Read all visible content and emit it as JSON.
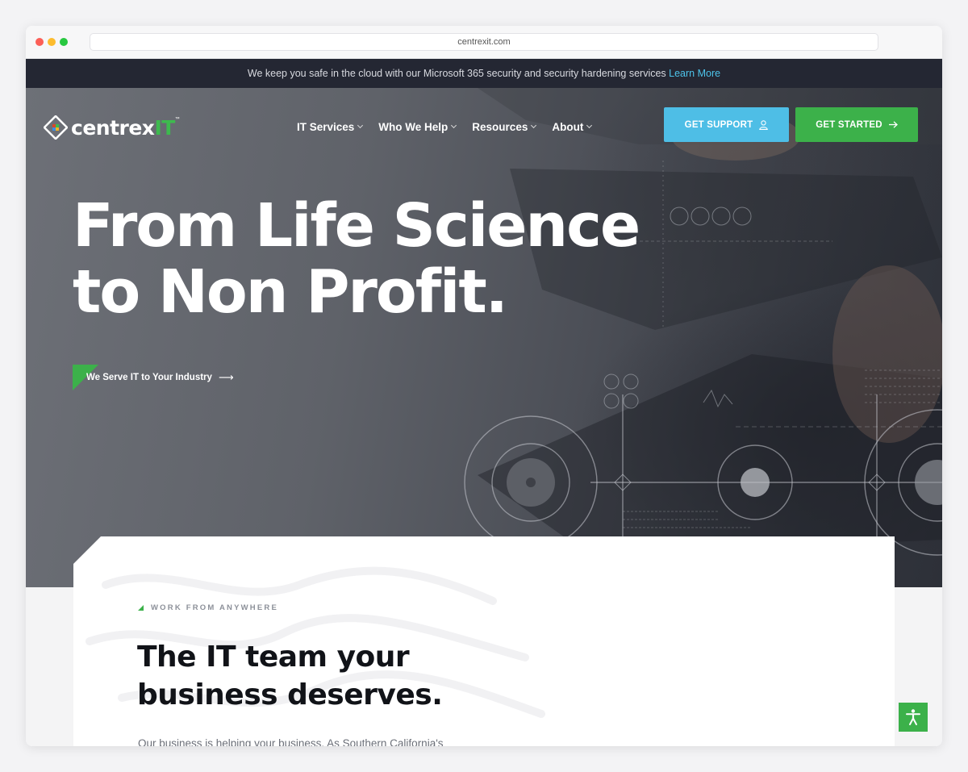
{
  "browser": {
    "url": "centrexit.com"
  },
  "announcement": {
    "text": "We keep you safe in the cloud with our Microsoft 365 security and security hardening services",
    "link_label": "Learn More"
  },
  "header": {
    "logo": {
      "text_main": "centrex",
      "text_accent": "IT",
      "trademark": "™"
    },
    "nav": [
      {
        "label": "IT Services"
      },
      {
        "label": "Who We Help"
      },
      {
        "label": "Resources"
      },
      {
        "label": "About"
      }
    ],
    "buttons": {
      "support_label": "GET SUPPORT",
      "started_label": "GET STARTED"
    }
  },
  "hero": {
    "headline_line1": "From Life Science",
    "headline_line2": "to Non Profit.",
    "cta_label": "We Serve IT to Your Industry"
  },
  "intro": {
    "eyebrow": "WORK FROM ANYWHERE",
    "title_line1": "The IT team your",
    "title_line2": "business deserves.",
    "body": "Our business is helping your business. As Southern California's"
  },
  "colors": {
    "brand_green": "#3cb14a",
    "support_blue": "#4ebee6",
    "announce_bg": "#242733",
    "link_blue": "#4dc3ea"
  },
  "icons": {
    "support_button": "user-icon",
    "started_button": "arrow-right-icon",
    "nav_dropdown": "chevron-down-icon",
    "accessibility": "accessibility-icon"
  }
}
